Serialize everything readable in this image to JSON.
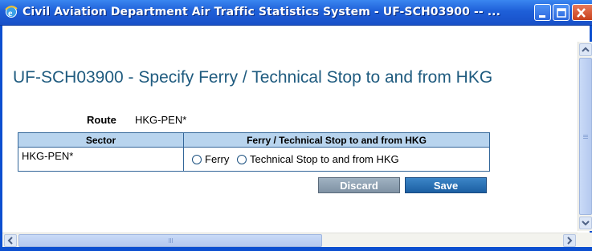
{
  "window": {
    "title": "Civil Aviation Department Air Traffic Statistics System - UF-SCH03900 -- ..."
  },
  "page": {
    "heading": "UF-SCH03900 - Specify Ferry / Technical Stop to and from HKG"
  },
  "route": {
    "label": "Route",
    "value": "HKG-PEN*"
  },
  "table": {
    "headers": [
      "Sector",
      "Ferry / Technical Stop to and from HKG"
    ],
    "rows": [
      {
        "sector": "HKG-PEN*",
        "options": [
          "Ferry",
          "Technical Stop to and from HKG"
        ]
      }
    ]
  },
  "buttons": {
    "discard": "Discard",
    "save": "Save"
  },
  "icons": {
    "app": "ie-icon",
    "minimize": "minimize-icon",
    "maximize": "maximize-icon",
    "close": "close-icon"
  },
  "colors": {
    "titlebar": "#1e5fd8",
    "heading": "#1f5b7f",
    "table_header": "#b8d4ee",
    "save_button": "#1c5fa2",
    "discard_button": "#8a9cae"
  }
}
